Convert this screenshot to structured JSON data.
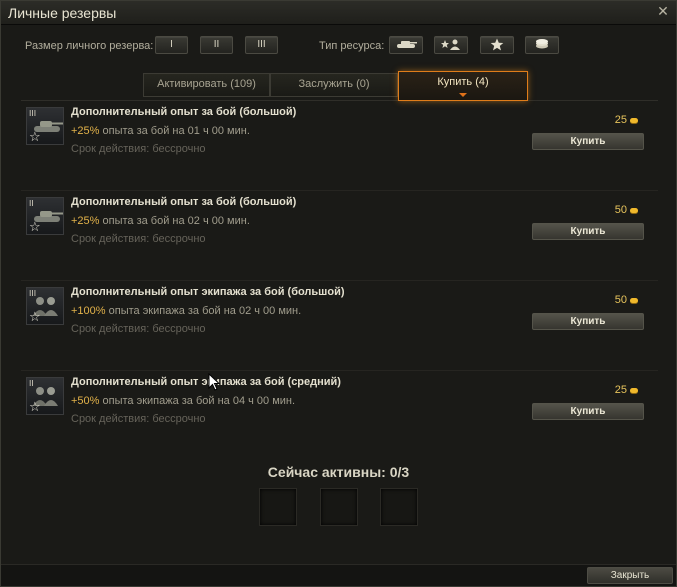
{
  "window": {
    "title": "Личные резервы",
    "close_glyph": "✕"
  },
  "filters": {
    "size_label": "Размер личного резерва:",
    "sizes": [
      "I",
      "II",
      "III"
    ],
    "resource_label": "Тип ресурса:",
    "resource_icons": [
      "tank-icon",
      "crew-icon",
      "star-icon",
      "credits-icon"
    ]
  },
  "tabs": [
    {
      "label": "Активировать (109)",
      "active": false
    },
    {
      "label": "Заслужить (0)",
      "active": false
    },
    {
      "label": "Купить (4)",
      "active": true
    }
  ],
  "items": [
    {
      "tier": "III",
      "image": "tank",
      "name": "Дополнительный опыт за бой (большой)",
      "percent": "+25%",
      "desc": " опыта за бой на 01 ч 00 мин.",
      "term": "Срок действия: бессрочно",
      "price": "25",
      "button": "Купить"
    },
    {
      "tier": "II",
      "image": "tank",
      "name": "Дополнительный опыт за бой (большой)",
      "percent": "+25%",
      "desc": " опыта за бой на 02 ч 00 мин.",
      "term": "Срок действия: бессрочно",
      "price": "50",
      "button": "Купить"
    },
    {
      "tier": "III",
      "image": "crew",
      "name": "Дополнительный опыт экипажа за бой (большой)",
      "percent": "+100%",
      "desc": " опыта экипажа за бой на 02 ч 00 мин.",
      "term": "Срок действия: бессрочно",
      "price": "50",
      "button": "Купить"
    },
    {
      "tier": "II",
      "image": "crew",
      "name": "Дополнительный опыт экипажа за бой (средний)",
      "percent": "+50%",
      "desc": " опыта экипажа за бой на 04 ч 00 мин.",
      "term": "Срок действия: бессрочно",
      "price": "25",
      "button": "Купить"
    }
  ],
  "active": {
    "title": "Сейчас активны: 0/3",
    "slots": 3
  },
  "footer": {
    "close_label": "Закрыть"
  },
  "colors": {
    "accent": "#e07d1a",
    "gold": "#e7c45c",
    "percent": "#e2b24a"
  }
}
